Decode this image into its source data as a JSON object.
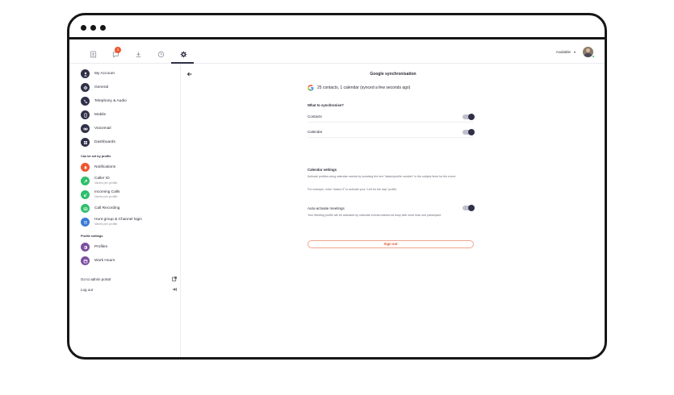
{
  "topnav": {
    "notification_count": "1",
    "status_label": "Available",
    "icons": [
      "contacts-icon",
      "chat-icon",
      "download-icon",
      "history-icon",
      "settings-icon"
    ]
  },
  "sidebar": {
    "items": [
      {
        "label": "My Account",
        "icon": "user-icon",
        "color": "#2f3048"
      },
      {
        "label": "General",
        "icon": "gear-icon",
        "color": "#2f3048"
      },
      {
        "label": "Telephony & Audio",
        "icon": "phone-icon",
        "color": "#2f3048"
      },
      {
        "label": "Mobile",
        "icon": "mobile-icon",
        "color": "#2f3048"
      },
      {
        "label": "Voicemail",
        "icon": "voicemail-icon",
        "color": "#2f3048"
      },
      {
        "label": "Dashboards",
        "icon": "dashboard-icon",
        "color": "#2f3048"
      }
    ],
    "profile_section_title": "Can be set by profile",
    "profile_items": [
      {
        "label": "Notifications",
        "sub": "",
        "icon": "bell-icon",
        "color": "#f0562e"
      },
      {
        "label": "Caller ID",
        "sub": "Varies per profile",
        "icon": "outgoing-call-icon",
        "color": "#2ec06b"
      },
      {
        "label": "Incoming Calls",
        "sub": "Varies per profile",
        "icon": "incoming-call-icon",
        "color": "#2ec06b"
      },
      {
        "label": "Call Recording",
        "sub": "",
        "icon": "record-icon",
        "color": "#2ec06b"
      },
      {
        "label": "Hunt group & Channel login",
        "sub": "Varies per profile",
        "icon": "group-icon",
        "color": "#3a7bd5"
      }
    ],
    "settings_section_title": "Profile settings",
    "settings_items": [
      {
        "label": "Profiles",
        "icon": "profiles-icon",
        "color": "#7b4fa0"
      },
      {
        "label": "Work Hours",
        "icon": "calendar-icon",
        "color": "#7b4fa0"
      }
    ],
    "admin_link": "Go to admin portal",
    "logout_link": "Log out"
  },
  "main": {
    "title": "Google synchronisation",
    "sync_status": "25 contacts, 1 calendar (synced a few seconds ago)",
    "what_title": "What to synchronise?",
    "contacts_label": "Contacts",
    "calendar_label": "Calendar",
    "calendar_settings_title": "Calendar settings",
    "calendar_desc": "Activate profiles using calendar events by including the text \"status/profile number\" in the subject-lines for the event.",
    "calendar_example": "For example, enter \"status:3\" to activate your \"Left for the day\" profile.",
    "auto_label": "Auto-activate meetings",
    "auto_desc": "Your Meeting profile will be activated by calendar events marked as busy with more than one participant.",
    "signout_label": "Sign out"
  }
}
